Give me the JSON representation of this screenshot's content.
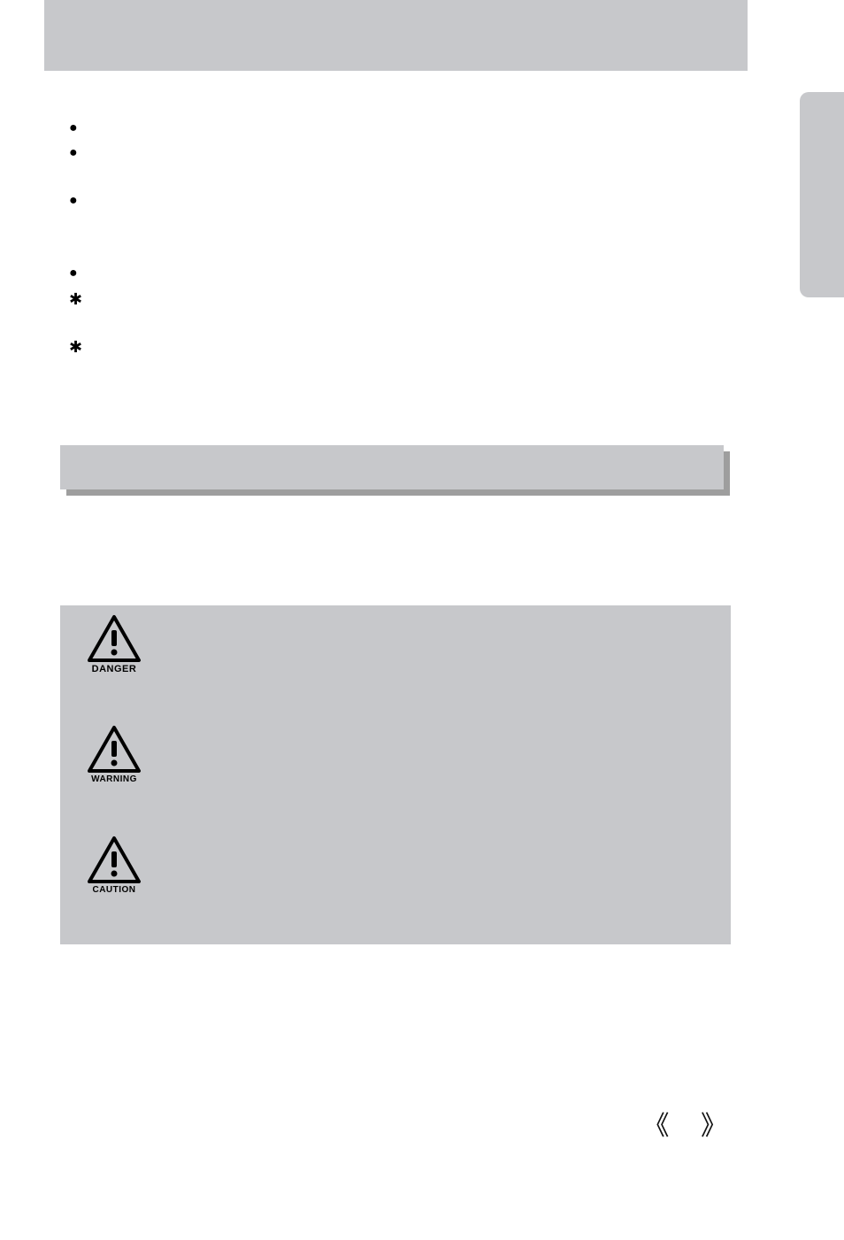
{
  "bullets": [
    {
      "type": "dot",
      "text": ""
    },
    {
      "type": "dot",
      "text": ""
    },
    {
      "type": "space",
      "text": ""
    },
    {
      "type": "dot",
      "text": ""
    },
    {
      "type": "space",
      "text": ""
    },
    {
      "type": "space",
      "text": ""
    },
    {
      "type": "dot",
      "text": ""
    },
    {
      "type": "star",
      "text": ""
    },
    {
      "type": "space",
      "text": ""
    },
    {
      "type": "star",
      "text": ""
    }
  ],
  "warnings": [
    {
      "label": "DANGER",
      "size": 11
    },
    {
      "label": "WARNING",
      "size": 10
    },
    {
      "label": "CAUTION",
      "size": 10
    }
  ],
  "angle_quotes": "《 》"
}
